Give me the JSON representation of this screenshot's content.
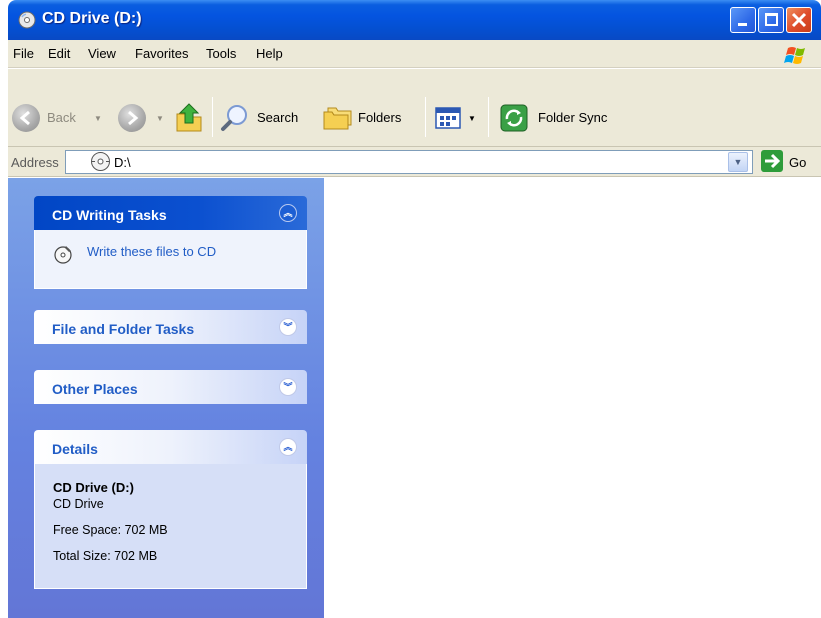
{
  "window": {
    "title": "CD Drive (D:)",
    "icon": "cd-drive-icon"
  },
  "menu": {
    "items": [
      "File",
      "Edit",
      "View",
      "Favorites",
      "Tools",
      "Help"
    ]
  },
  "toolbar": {
    "back_label": "Back",
    "search_label": "Search",
    "folders_label": "Folders",
    "folder_sync_label": "Folder Sync"
  },
  "address": {
    "label": "Address",
    "value": "D:\\",
    "go_label": "Go"
  },
  "sidebar": {
    "cd_writing": {
      "title": "CD Writing Tasks",
      "task_label": "Write these files to CD",
      "expanded": true
    },
    "file_folder": {
      "title": "File and Folder Tasks",
      "expanded": false
    },
    "other_places": {
      "title": "Other Places",
      "expanded": false
    },
    "details": {
      "title": "Details",
      "expanded": true,
      "name": "CD Drive (D:)",
      "type": "CD Drive",
      "free_space": "Free Space: 702 MB",
      "total_size": "Total Size: 702 MB"
    }
  },
  "colors": {
    "titlebar": "#0454e0",
    "sidebar_bg": "#6f8ee2",
    "link": "#215dc6",
    "chrome": "#ece9d8"
  }
}
